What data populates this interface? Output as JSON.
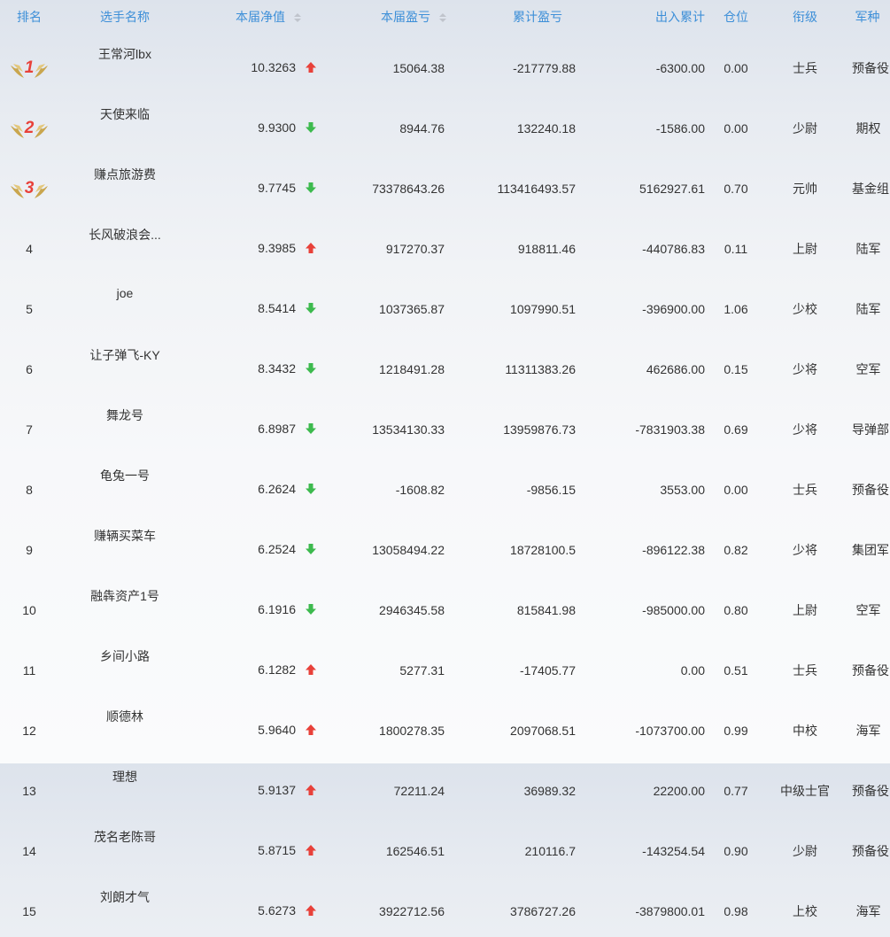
{
  "headers": {
    "rank": "排名",
    "name": "选手名称",
    "nav": "本届净值",
    "current_pl": "本届盈亏",
    "cumulative_pl": "累计盈亏",
    "in_out": "出入累计",
    "position": "仓位",
    "title": "衔级",
    "arm": "军种"
  },
  "colors": {
    "header_text": "#3d8fd8",
    "up": "#e8413a",
    "down": "#3dba4e",
    "medal_number": "#e8413a",
    "medal_wing": "#c9a64e"
  },
  "rows": [
    {
      "rank": "1",
      "name": "王常河lbx",
      "nav": "10.3263",
      "trend": "up",
      "current_pl": "15064.38",
      "cumulative_pl": "-217779.88",
      "in_out": "-6300.00",
      "position": "0.00",
      "title": "士兵",
      "arm": "预备役"
    },
    {
      "rank": "2",
      "name": "天使来临",
      "nav": "9.9300",
      "trend": "down",
      "current_pl": "8944.76",
      "cumulative_pl": "132240.18",
      "in_out": "-1586.00",
      "position": "0.00",
      "title": "少尉",
      "arm": "期权"
    },
    {
      "rank": "3",
      "name": "赚点旅游费",
      "nav": "9.7745",
      "trend": "down",
      "current_pl": "73378643.26",
      "cumulative_pl": "113416493.57",
      "in_out": "5162927.61",
      "position": "0.70",
      "title": "元帅",
      "arm": "基金组"
    },
    {
      "rank": "4",
      "name": "长风破浪会...",
      "nav": "9.3985",
      "trend": "up",
      "current_pl": "917270.37",
      "cumulative_pl": "918811.46",
      "in_out": "-440786.83",
      "position": "0.11",
      "title": "上尉",
      "arm": "陆军"
    },
    {
      "rank": "5",
      "name": "joe",
      "nav": "8.5414",
      "trend": "down",
      "current_pl": "1037365.87",
      "cumulative_pl": "1097990.51",
      "in_out": "-396900.00",
      "position": "1.06",
      "title": "少校",
      "arm": "陆军"
    },
    {
      "rank": "6",
      "name": "让子弹飞-KY",
      "nav": "8.3432",
      "trend": "down",
      "current_pl": "1218491.28",
      "cumulative_pl": "11311383.26",
      "in_out": "462686.00",
      "position": "0.15",
      "title": "少将",
      "arm": "空军"
    },
    {
      "rank": "7",
      "name": "舞龙号",
      "nav": "6.8987",
      "trend": "down",
      "current_pl": "13534130.33",
      "cumulative_pl": "13959876.73",
      "in_out": "-7831903.38",
      "position": "0.69",
      "title": "少将",
      "arm": "导弹部队"
    },
    {
      "rank": "8",
      "name": "龟兔一号",
      "nav": "6.2624",
      "trend": "down",
      "current_pl": "-1608.82",
      "cumulative_pl": "-9856.15",
      "in_out": "3553.00",
      "position": "0.00",
      "title": "士兵",
      "arm": "预备役"
    },
    {
      "rank": "9",
      "name": "赚辆买菜车",
      "nav": "6.2524",
      "trend": "down",
      "current_pl": "13058494.22",
      "cumulative_pl": "18728100.5",
      "in_out": "-896122.38",
      "position": "0.82",
      "title": "少将",
      "arm": "集团军"
    },
    {
      "rank": "10",
      "name": "融犇资产1号",
      "nav": "6.1916",
      "trend": "down",
      "current_pl": "2946345.58",
      "cumulative_pl": "815841.98",
      "in_out": "-985000.00",
      "position": "0.80",
      "title": "上尉",
      "arm": "空军"
    },
    {
      "rank": "11",
      "name": "乡间小路",
      "nav": "6.1282",
      "trend": "up",
      "current_pl": "5277.31",
      "cumulative_pl": "-17405.77",
      "in_out": "0.00",
      "position": "0.51",
      "title": "士兵",
      "arm": "预备役"
    },
    {
      "rank": "12",
      "name": "顺德林",
      "nav": "5.9640",
      "trend": "up",
      "current_pl": "1800278.35",
      "cumulative_pl": "2097068.51",
      "in_out": "-1073700.00",
      "position": "0.99",
      "title": "中校",
      "arm": "海军"
    },
    {
      "rank": "13",
      "name": "理想",
      "nav": "5.9137",
      "trend": "up",
      "current_pl": "72211.24",
      "cumulative_pl": "36989.32",
      "in_out": "22200.00",
      "position": "0.77",
      "title": "中级士官",
      "arm": "预备役"
    },
    {
      "rank": "14",
      "name": "茂名老陈哥",
      "nav": "5.8715",
      "trend": "up",
      "current_pl": "162546.51",
      "cumulative_pl": "210116.7",
      "in_out": "-143254.54",
      "position": "0.90",
      "title": "少尉",
      "arm": "预备役"
    },
    {
      "rank": "15",
      "name": "刘朗才气",
      "nav": "5.6273",
      "trend": "up",
      "current_pl": "3922712.56",
      "cumulative_pl": "3786727.26",
      "in_out": "-3879800.01",
      "position": "0.98",
      "title": "上校",
      "arm": "海军"
    }
  ]
}
